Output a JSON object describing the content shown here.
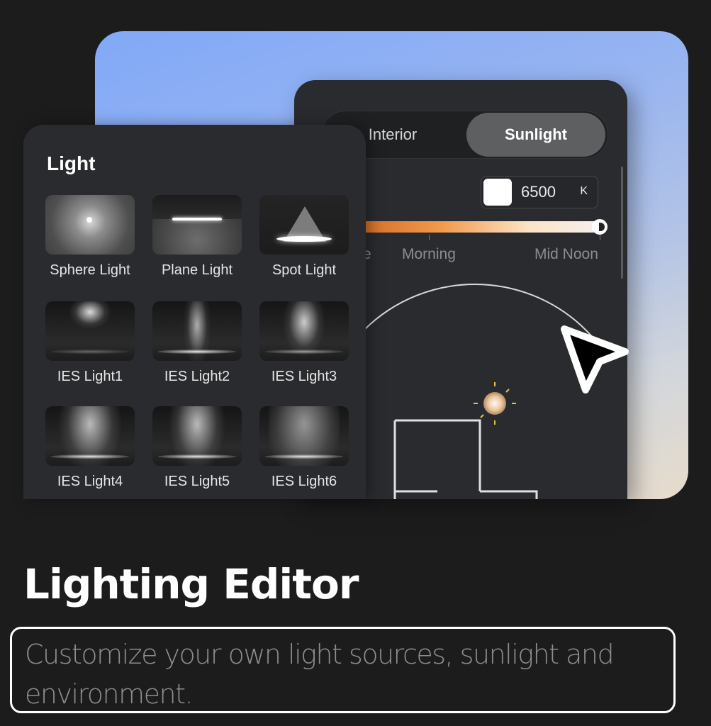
{
  "hero": {
    "sunlight_panel": {
      "tabs": [
        {
          "label": "Interior",
          "active": false
        },
        {
          "label": "Sunlight",
          "active": true
        }
      ],
      "color_temperature": {
        "value": "6500",
        "unit": "K",
        "swatch_color": "#ffffff"
      },
      "time_slider": {
        "ticks": [
          {
            "label": "e"
          },
          {
            "label": "Morning"
          },
          {
            "label": "Mid Noon"
          }
        ],
        "value_fraction": 1.0,
        "gradient_colors": [
          "#d26a24",
          "#f29a4c",
          "#fde3c6",
          "#f4f0ee"
        ]
      }
    },
    "light_panel": {
      "title": "Light",
      "items": [
        {
          "label": "Sphere Light",
          "icon": "sphere-light-icon"
        },
        {
          "label": "Plane Light",
          "icon": "plane-light-icon"
        },
        {
          "label": "Spot Light",
          "icon": "spot-light-icon"
        },
        {
          "label": "IES Light1",
          "icon": "ies-light-icon"
        },
        {
          "label": "IES Light2",
          "icon": "ies-light-icon"
        },
        {
          "label": "IES Light3",
          "icon": "ies-light-icon"
        },
        {
          "label": "IES Light4",
          "icon": "ies-light-icon"
        },
        {
          "label": "IES Light5",
          "icon": "ies-light-icon"
        },
        {
          "label": "IES Light6",
          "icon": "ies-light-icon"
        }
      ]
    }
  },
  "headline": "Lighting Editor",
  "description": "Customize your own light sources, sunlight and environment.",
  "colors": {
    "background": "#1c1c1d",
    "panel": "#2a2b2e",
    "accent_orange": "#f29a4c",
    "sun_glow": "#e9c9a3"
  }
}
